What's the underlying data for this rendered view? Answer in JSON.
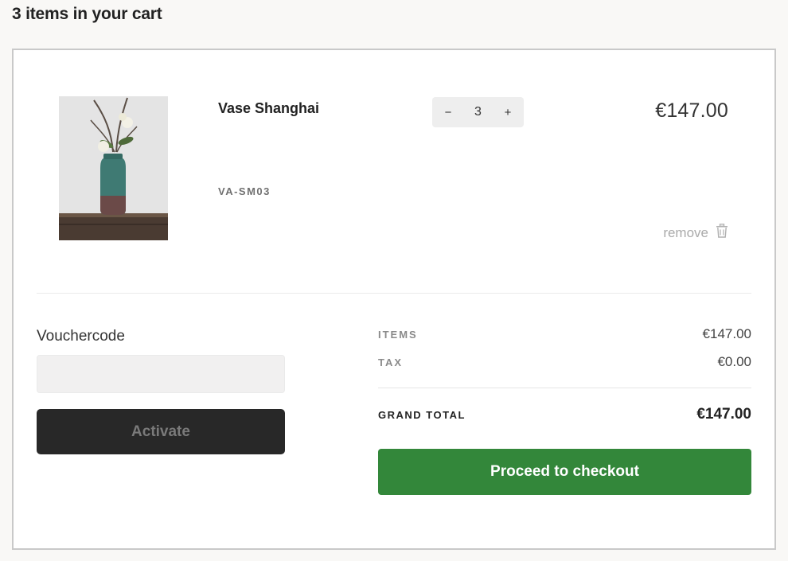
{
  "page": {
    "title": "3 items in your cart"
  },
  "cart": {
    "items": [
      {
        "name": "Vase Shanghai",
        "sku": "VA-SM03",
        "quantity": "3",
        "decrement_label": "−",
        "increment_label": "+",
        "price": "€147.00",
        "remove_label": "remove",
        "remove_icon": "trash-icon",
        "image_description_icon": "vase-image"
      }
    ]
  },
  "voucher": {
    "label": "Vouchercode",
    "value": "",
    "placeholder": "",
    "button_label": "Activate"
  },
  "summary": {
    "items_label": "ITEMS",
    "items_value": "€147.00",
    "tax_label": "TAX",
    "tax_value": "€0.00",
    "grand_total_label": "GRAND TOTAL",
    "grand_total_value": "€147.00",
    "checkout_label": "Proceed to checkout"
  },
  "colors": {
    "checkout_green": "#33873a",
    "activate_dark": "#282828",
    "page_background": "#f9f8f6"
  }
}
